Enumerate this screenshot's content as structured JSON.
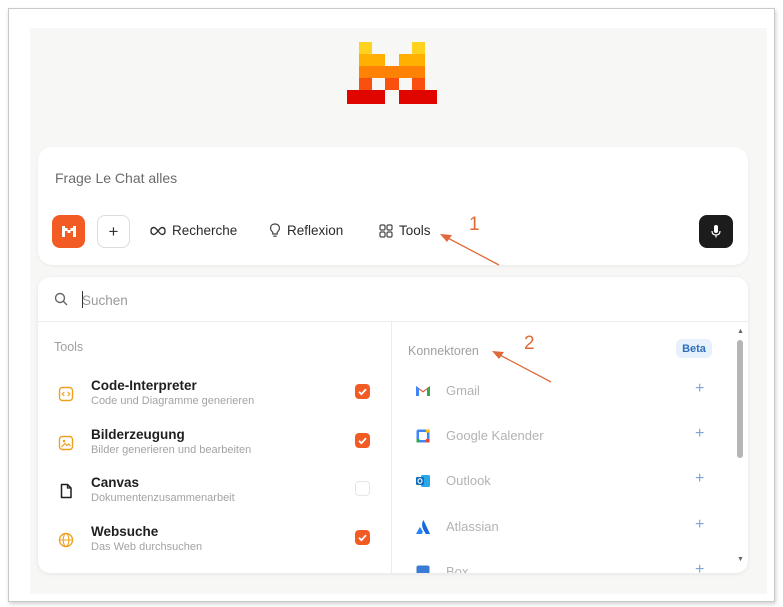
{
  "chat": {
    "placeholder": "Frage Le Chat alles",
    "buttons": {
      "recherche": "Recherche",
      "reflexion": "Reflexion",
      "tools": "Tools"
    }
  },
  "annotations": {
    "one": "1",
    "two": "2"
  },
  "search": {
    "placeholder": "Suchen"
  },
  "tools_section": {
    "label": "Tools",
    "items": [
      {
        "name": "Code-Interpreter",
        "desc": "Code und Diagramme generieren",
        "checked": true,
        "icon": "code-icon"
      },
      {
        "name": "Bilderzeugung",
        "desc": "Bilder generieren und bearbeiten",
        "checked": true,
        "icon": "image-icon"
      },
      {
        "name": "Canvas",
        "desc": "Dokumentenzusammenarbeit",
        "checked": false,
        "icon": "document-icon"
      },
      {
        "name": "Websuche",
        "desc": "Das Web durchsuchen",
        "checked": true,
        "icon": "globe-icon"
      }
    ]
  },
  "connectors_section": {
    "label": "Konnektoren",
    "badge": "Beta",
    "items": [
      {
        "name": "Gmail",
        "icon": "gmail-icon"
      },
      {
        "name": "Google Kalender",
        "icon": "google-calendar-icon"
      },
      {
        "name": "Outlook",
        "icon": "outlook-icon"
      },
      {
        "name": "Atlassian",
        "icon": "atlassian-icon"
      },
      {
        "name": "Box",
        "icon": "box-icon"
      }
    ],
    "add_symbol": "+"
  },
  "colors": {
    "accent": "#f25c24",
    "annotation": "#e06a3a",
    "badge_bg": "#e6f1fb",
    "badge_text": "#2f6fbf"
  }
}
